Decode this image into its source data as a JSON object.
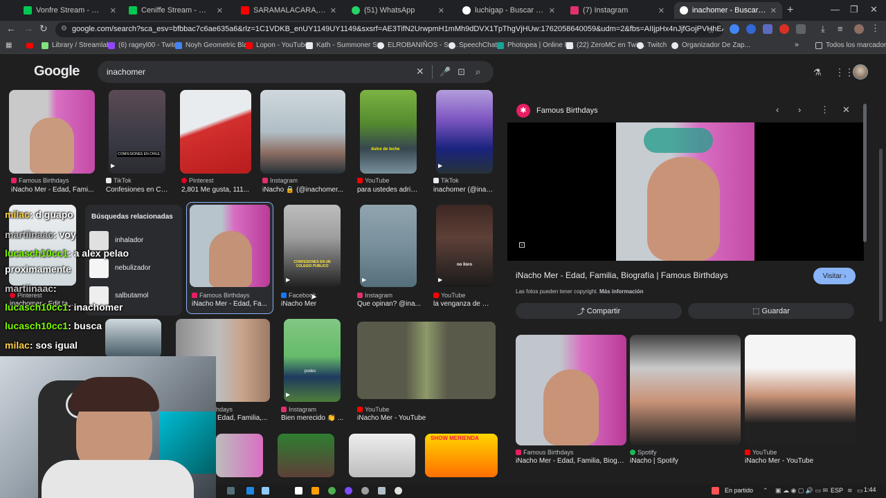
{
  "tabs": [
    {
      "label": "Vonfre Stream - Watch Live",
      "color": "#00c853"
    },
    {
      "label": "Ceniffe Stream - Watch Live on",
      "color": "#00c853"
    },
    {
      "label": "SARAMALACARA, Rojuu - BAP",
      "color": "#ff0000"
    },
    {
      "label": "(51) WhatsApp",
      "color": "#25d366"
    },
    {
      "label": "luchigap - Buscar con Google",
      "color": "#ffffff"
    },
    {
      "label": "(7) Instagram",
      "color": "#e1306c"
    },
    {
      "label": "inachomer - Buscar con Google",
      "color": "#ffffff"
    }
  ],
  "address": {
    "url": "google.com/search?sca_esv=bfbbac7c6ae635a6&rlz=1C1VDKB_enUY1149UY1149&sxsrf=AE3TifN2UrwpmH1mMh9dDVX1TpThgVjHUw:1762058640059&udm=2&fbs=AIIjpHx4nJjfGojPVHhEACUHPiMQht6_BFq6vBIoFFRK..."
  },
  "bookmarks": [
    {
      "label": "Library / Streamlabs",
      "color": "#80e27e"
    },
    {
      "label": "(6) rageyl00 - Twitch",
      "color": "#9146ff"
    },
    {
      "label": "Noyh Geometric Bla...",
      "color": "#4285f4"
    },
    {
      "label": "Lopon - YouTube",
      "color": "#ff0000"
    },
    {
      "label": "Kạth - Summoner St...",
      "color": "#e8eaed"
    },
    {
      "label": "ELROBANIÑOS - Su...",
      "color": "#e8eaed"
    },
    {
      "label": "SpeechChat",
      "color": "#e8eaed"
    },
    {
      "label": "Photopea | Online P...",
      "color": "#18a497"
    },
    {
      "label": "(22) ZeroMC en Twit...",
      "color": "#e8eaed"
    },
    {
      "label": "Twitch",
      "color": "#e8eaed"
    },
    {
      "label": "Organizador De Zap...",
      "color": "#e8eaed"
    },
    {
      "label": "Todos los marcadores",
      "color": "#e8eaed"
    }
  ],
  "google": {
    "logo": "Google",
    "query": "inachomer"
  },
  "results": [
    {
      "source": "Famous Birthdays",
      "title": "iNacho Mer - Edad, Fami...",
      "src_color": "#e91e63"
    },
    {
      "source": "TikTok",
      "title": "Confesiones en Ch...",
      "src_color": "#e8eaed",
      "thumb_text": "CONFESIONES EN CHILE"
    },
    {
      "source": "Pinterest",
      "title": "2,801 Me gusta, 111...",
      "src_color": "#e60023"
    },
    {
      "source": "Instagram",
      "title": "iNacho 🔒 (@inachomer...",
      "src_color": "#e1306c"
    },
    {
      "source": "YouTube",
      "title": "para ustedes adria...",
      "src_color": "#ff0000",
      "thumb_text": "dulce de leche"
    },
    {
      "source": "TikTok",
      "title": "inachomer (@inac...",
      "src_color": "#e8eaed"
    },
    {
      "source": "Famous Birthdays",
      "title": "iNacho Mer - Edad, Fa...",
      "src_color": "#e91e63"
    },
    {
      "source": "Facebook",
      "title": "iNacho Mer",
      "src_color": "#1877f2",
      "thumb_text": "CONFESIONES EN UN COLEGIO PUBLICO"
    },
    {
      "source": "Instagram",
      "title": "Que opinan? @ina...",
      "src_color": "#e1306c"
    },
    {
      "source": "YouTube",
      "title": "la venganza de mi...",
      "src_color": "#ff0000",
      "thumb_text": "no lloro"
    },
    {
      "source": "Pinterest",
      "title": "inachomer - Edit ta...",
      "src_color": "#e60023"
    },
    {
      "source": "",
      "title": "Edad, Familia,...",
      "src_color": "#e91e63",
      "source_partial": "hdays"
    },
    {
      "source": "Instagram",
      "title": "Bien merecido 👏 ...",
      "src_color": "#e1306c",
      "thumb_text": "podes"
    },
    {
      "source": "YouTube",
      "title": "iNacho Mer - YouTube",
      "src_color": "#ff0000"
    },
    {
      "source": "",
      "title": "",
      "thumb_text": "SHOW MERIENDA"
    }
  ],
  "related": {
    "heading": "Búsquedas relacionadas",
    "items": [
      "inhalador",
      "nebulizador",
      "salbutamol"
    ]
  },
  "chat": [
    {
      "user": "milac",
      "msg": ": d guapo",
      "color": "#ffd24d"
    },
    {
      "user": "martiinaac",
      "msg": ": voy",
      "color": "#9e9e9e"
    },
    {
      "user": "lucasch10cc1",
      "msg": ": a alex pelao",
      "color": "#7cfc00"
    },
    {
      "user": "",
      "msg": "proximamente",
      "color": "#ffffff"
    },
    {
      "user": "martiinaac",
      "msg": ":",
      "color": "#9e9e9e"
    },
    {
      "user": "lucasch10cc1",
      "msg": ": inachomer",
      "color": "#7cfc00"
    },
    {
      "user": "lucasch10cc1",
      "msg": ": busca",
      "color": "#7cfc00"
    },
    {
      "user": "milac",
      "msg": ": sos igual",
      "color": "#ffd24d"
    }
  ],
  "panel": {
    "site": "Famous Birthdays",
    "title": "iNacho Mer - Edad, Familia, Biografía | Famous Birthdays",
    "visit": "Visitar",
    "copyright": "Las fotos pueden tener copyright.",
    "more_info": "Más información",
    "share": "Compartir",
    "save": "Guardar",
    "related": [
      {
        "source": "Famous Birthdays",
        "title": "iNacho Mer - Edad, Familia, Biogra...",
        "color": "#e91e63"
      },
      {
        "source": "Spotify",
        "title": "iNacho | Spotify",
        "color": "#1db954"
      },
      {
        "source": "YouTube",
        "title": "iNacho Mer - YouTube",
        "color": "#ff0000"
      }
    ]
  },
  "taskbar": {
    "status": "En partido",
    "lang": "ESP",
    "time": "1:44"
  }
}
